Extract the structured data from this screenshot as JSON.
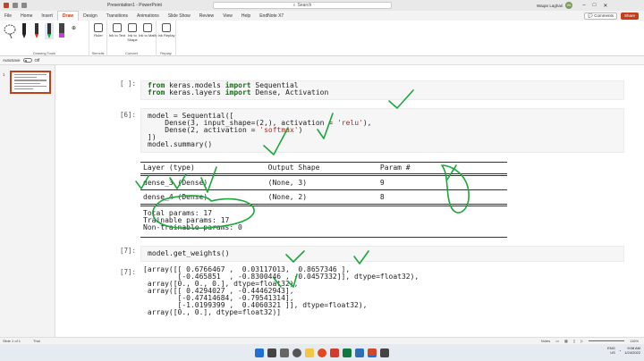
{
  "titlebar": {
    "document_title": "Presentation1 - PowerPoint",
    "search_placeholder": "Search",
    "user_name": "Waqar Laghari",
    "user_initials": "WL"
  },
  "menu": {
    "tabs": [
      "File",
      "Home",
      "Insert",
      "Draw",
      "Design",
      "Transitions",
      "Animations",
      "Slide Show",
      "Review",
      "View",
      "Help",
      "EndNote X7"
    ],
    "active_tab": "Draw",
    "comments_label": "Comments",
    "share_label": "Share"
  },
  "ribbon": {
    "group_drawing_tools": "Drawing Tools",
    "group_stencils": "Stencils",
    "group_convert": "Convert",
    "group_replay": "Replay",
    "ruler_label": "Ruler",
    "ink_to_text": "Ink to Text",
    "ink_to_shape": "Ink to Shape",
    "ink_to_math": "Ink to Math",
    "ink_replay": "Ink Replay"
  },
  "autosave": {
    "label": "AutoSave",
    "state": "Off"
  },
  "thumbnails": {
    "slide_number": "1"
  },
  "code": {
    "prompt_empty": "[ ]:",
    "prompt_6": "[6]:",
    "prompt_7": "[7]:",
    "imports": [
      {
        "kw1": "from",
        "mod": " keras.models ",
        "kw2": "import",
        "rest": " Sequential"
      },
      {
        "kw1": "from",
        "mod": " keras.layers ",
        "kw2": "import",
        "rest": " Dense, Activation"
      }
    ],
    "model_l1_a": "model = Sequential([",
    "model_l2_a": "    Dense(3, input_shape=(2,), activation =",
    "model_l2_str": "'relu'",
    "model_l2_b": "),",
    "model_l3_a": "    Dense(2, activation =",
    "model_l3_str": "'softmax'",
    "model_l3_b": ")",
    "model_l4": "])",
    "model_l5": "model.summary()",
    "summary_header": "Layer (type)                 Output Shape              Param #",
    "summary_row1": "dense_3 (Dense)              (None, 3)                 9",
    "summary_row2": "dense_4 (Dense)              (None, 2)                 8",
    "total_params": "Total params: 17",
    "trainable_params": "Trainable params: 17",
    "non_trainable": "Non-trainable params: 0",
    "get_weights": "model.get_weights()",
    "weights_lines": [
      "[array([[ 0.6766467 ,  0.03117013,  0.8657346 ],",
      "        [-0.465851  , -0.8300446 , -0.0457332]], dtype=float32),",
      " array([0., 0., 0.], dtype=float32),",
      " array([[ 0.4294027 , -0.44462943],",
      "        [-0.47414684, -0.79541314],",
      "        [-1.0199399 ,  0.4060321 ]], dtype=float32),",
      " array([0., 0.], dtype=float32)]"
    ]
  },
  "statusbar": {
    "slide_info": "Slide 1 of 1",
    "language": "Thai",
    "notes": "Notes",
    "zoom": "116%"
  },
  "tray": {
    "language": "ENG\nUS",
    "time": "9:08 AM",
    "date": "1/24/2022"
  },
  "colors": {
    "accent": "#c43e1c",
    "ink": "#1aa83a",
    "keyword": "#1a6a1a",
    "string": "#b8241d"
  }
}
